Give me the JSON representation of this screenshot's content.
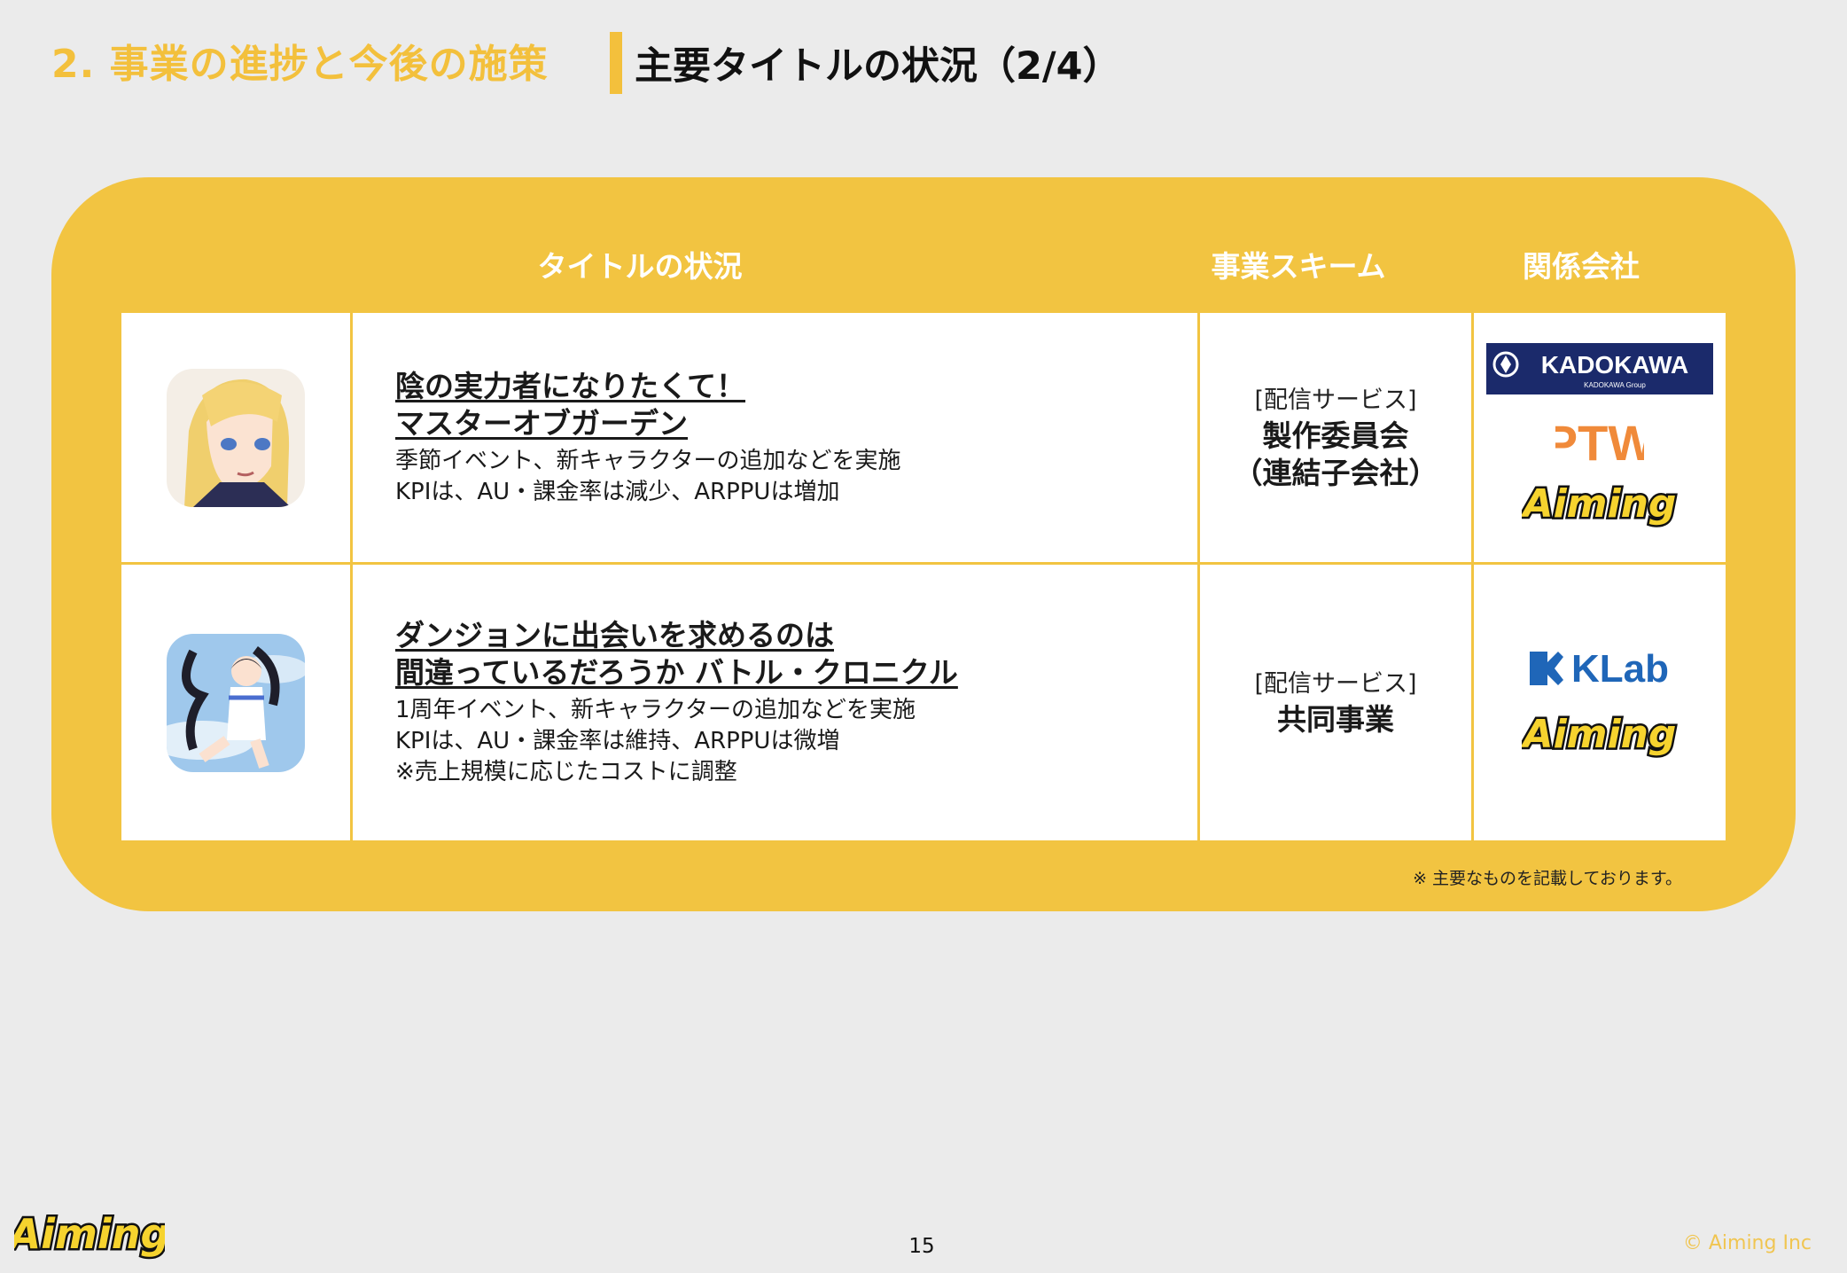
{
  "header": {
    "section_title": "2. 事業の進捗と今後の施策",
    "page_title": "主要タイトルの状況（2/4）"
  },
  "table": {
    "columns": [
      "タイトルの状況",
      "事業スキーム",
      "関係会社"
    ],
    "rows": [
      {
        "title_line1": "陰の実力者になりたくて！",
        "title_line2": "マスターオブガーデン",
        "desc_line1": "季節イベント、新キャラクターの追加などを実施",
        "desc_line2": "KPIは、AU・課金率は減少、ARPPUは増加",
        "desc_line3": "",
        "scheme_sub": "[配信サービス]",
        "scheme_main1": "製作委員会",
        "scheme_main2": "（連結子会社）",
        "partners": {
          "kadokawa": "KADOKAWA",
          "kadokawa_group": "KADOKAWA Group",
          "ptw": "PTW",
          "aiming": "Aiming"
        }
      },
      {
        "title_line1": "ダンジョンに出会いを求めるのは",
        "title_line2": "間違っているだろうか バトル・クロニクル",
        "desc_line1": "1周年イベント、新キャラクターの追加などを実施",
        "desc_line2": "KPIは、AU・課金率は維持、ARPPUは微増",
        "desc_line3": "※売上規模に応じたコストに調整",
        "scheme_sub": "[配信サービス]",
        "scheme_main1": "共同事業",
        "scheme_main2": "",
        "partners": {
          "klab": "KLab",
          "aiming": "Aiming"
        }
      }
    ]
  },
  "footnote": "※ 主要なものを記載しております。",
  "footer": {
    "page_number": "15",
    "copyright": "© Aiming Inc",
    "logo": "Aiming"
  },
  "colors": {
    "accent": "#f2c441",
    "ptw_orange": "#f08a3a",
    "kadokawa_navy": "#1b2a6b",
    "klab_blue": "#1f66b8"
  }
}
